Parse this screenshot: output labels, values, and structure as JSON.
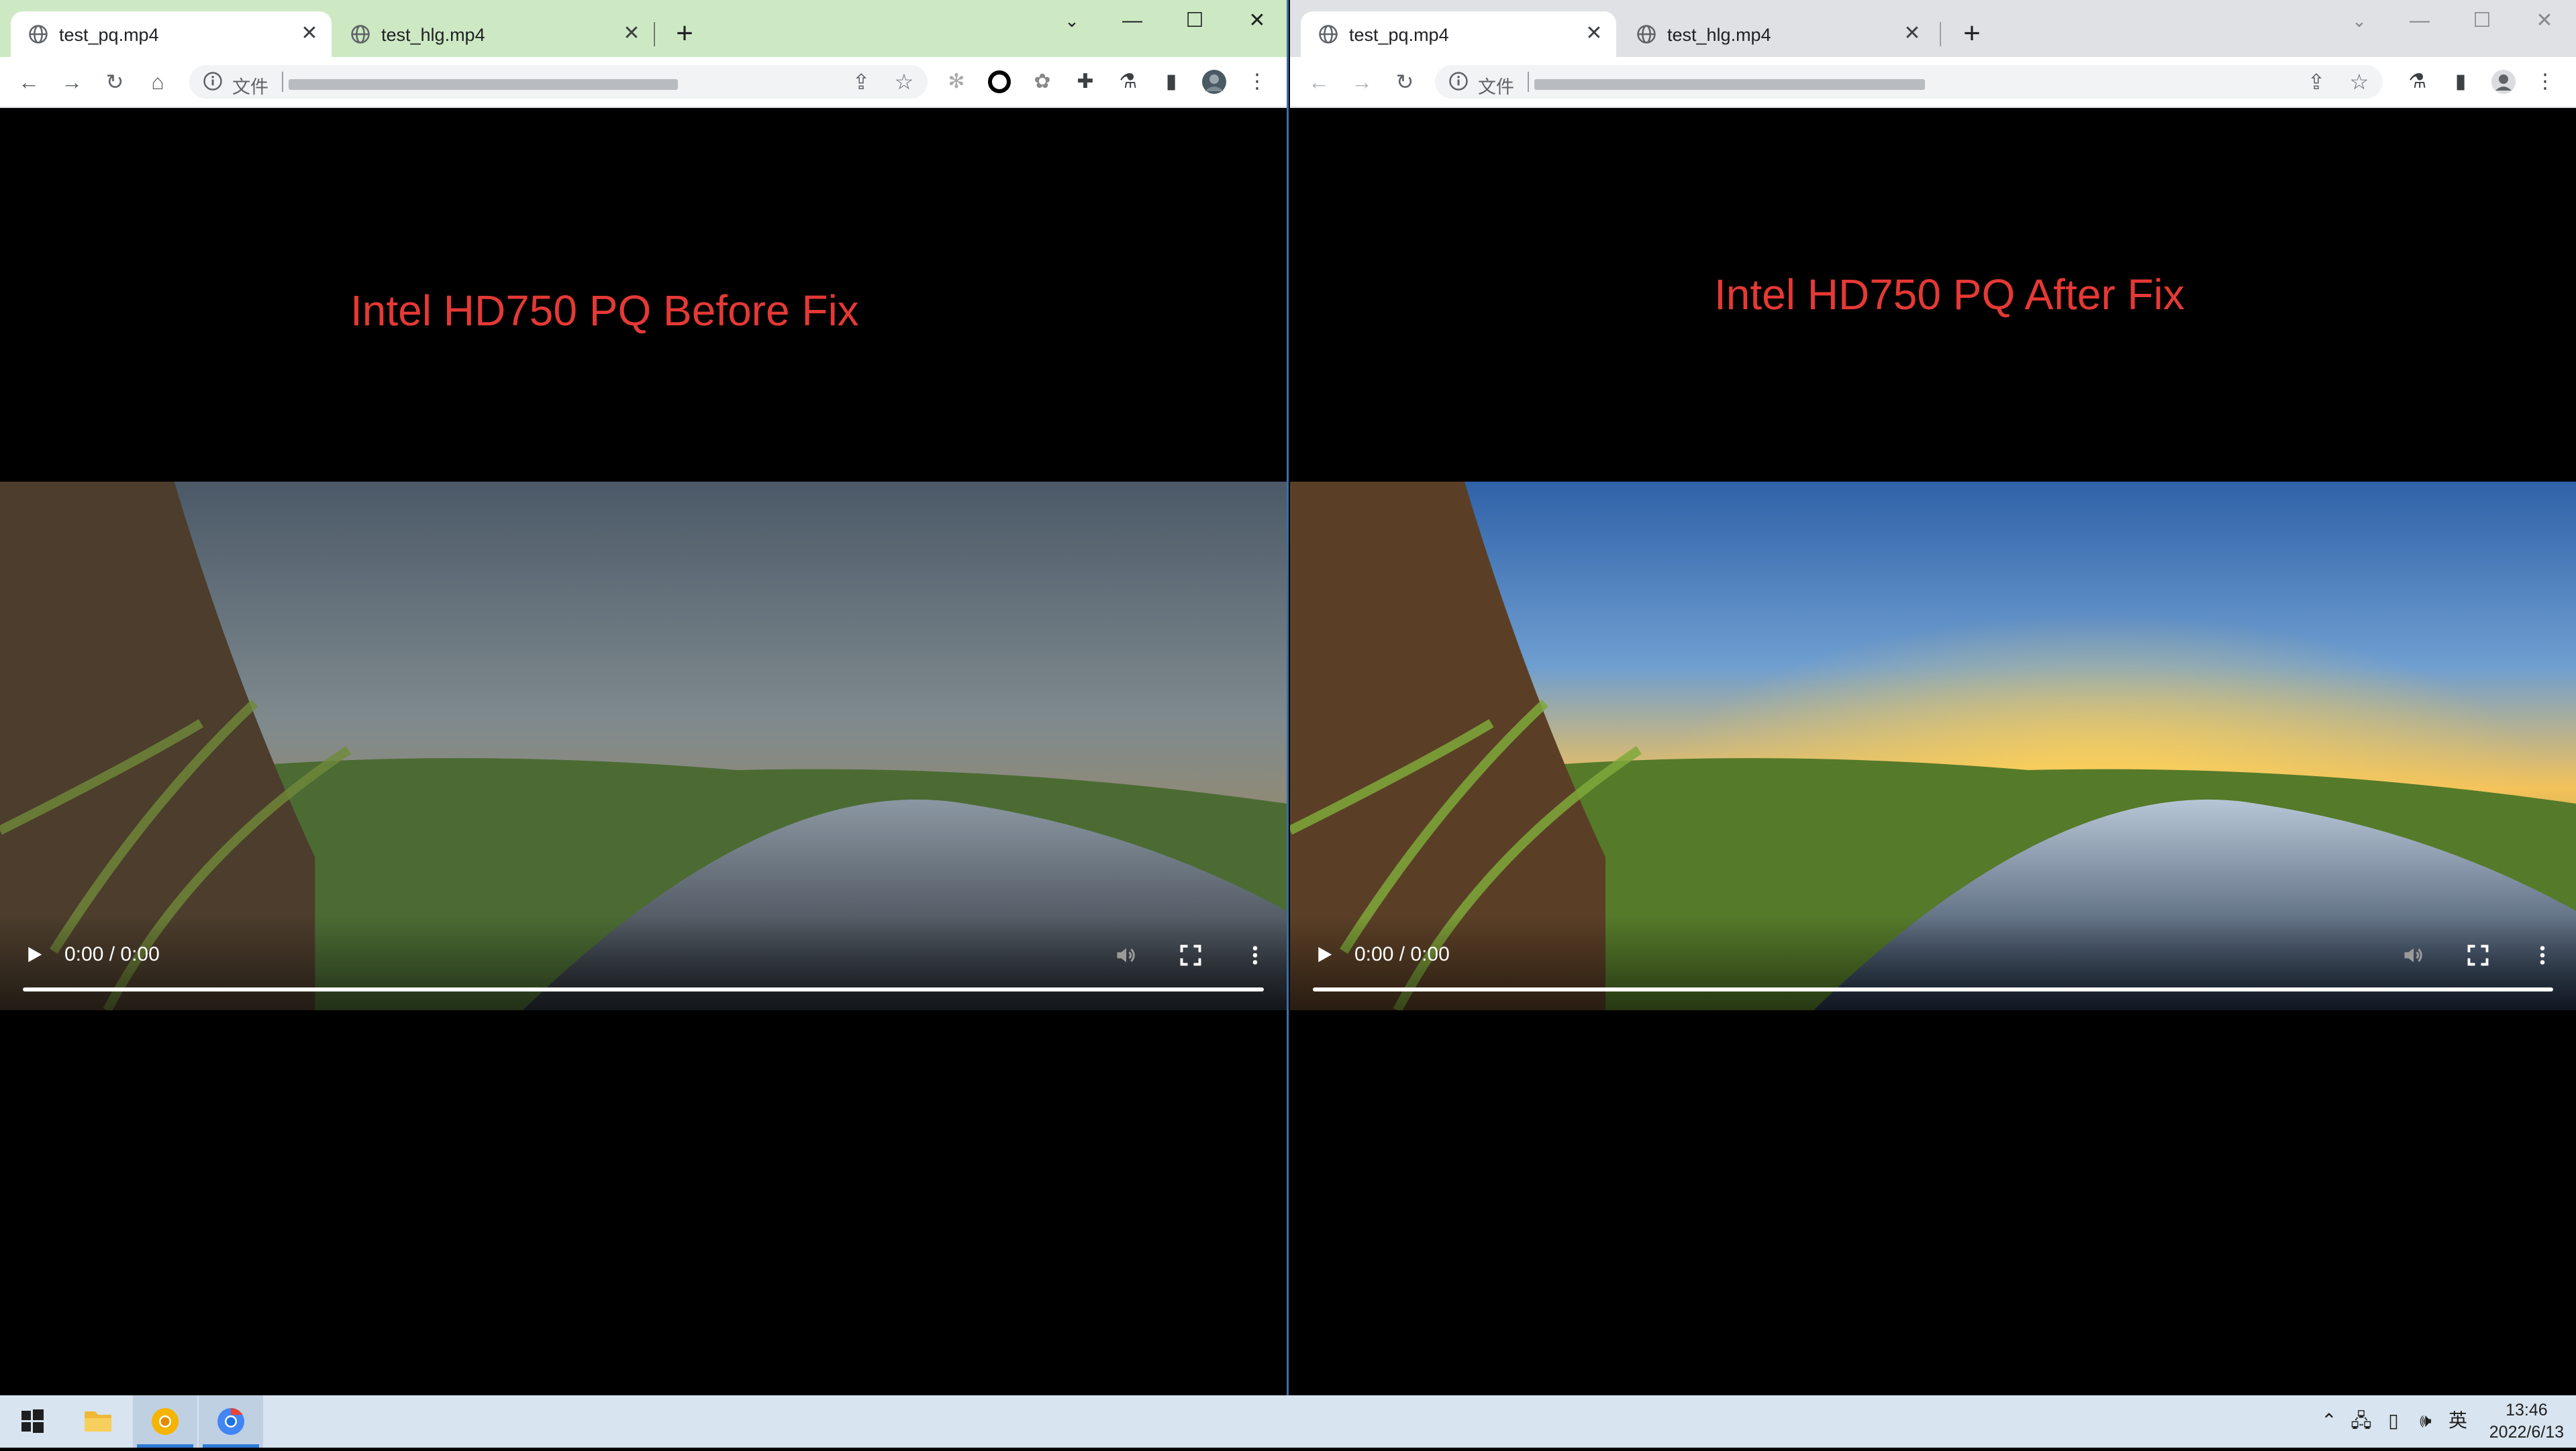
{
  "left_window": {
    "tabs": [
      {
        "title": "test_pq.mp4",
        "active": true
      },
      {
        "title": "test_hlg.mp4",
        "active": false
      }
    ],
    "omnibox_scheme": "文件",
    "heading": "Intel HD750 PQ Before Fix",
    "video": {
      "time": "0:00 / 0:00",
      "progress": 1.0
    }
  },
  "right_window": {
    "tabs": [
      {
        "title": "test_pq.mp4",
        "active": true
      },
      {
        "title": "test_hlg.mp4",
        "active": false
      }
    ],
    "omnibox_scheme": "文件",
    "heading": "Intel HD750 PQ After Fix",
    "video": {
      "time": "0:00 / 0:00",
      "progress": 1.0
    }
  },
  "taskbar": {
    "apps": [
      "start",
      "file-explorer",
      "chrome-canary",
      "chrome"
    ],
    "tray": {
      "input_method": "英",
      "time": "13:46",
      "date": "2022/6/13"
    }
  },
  "colors": {
    "heading": "#e53935",
    "left_titlebar": "#cde9c3",
    "right_titlebar": "#dfe1e5",
    "taskbar": "#d8e4ef"
  }
}
